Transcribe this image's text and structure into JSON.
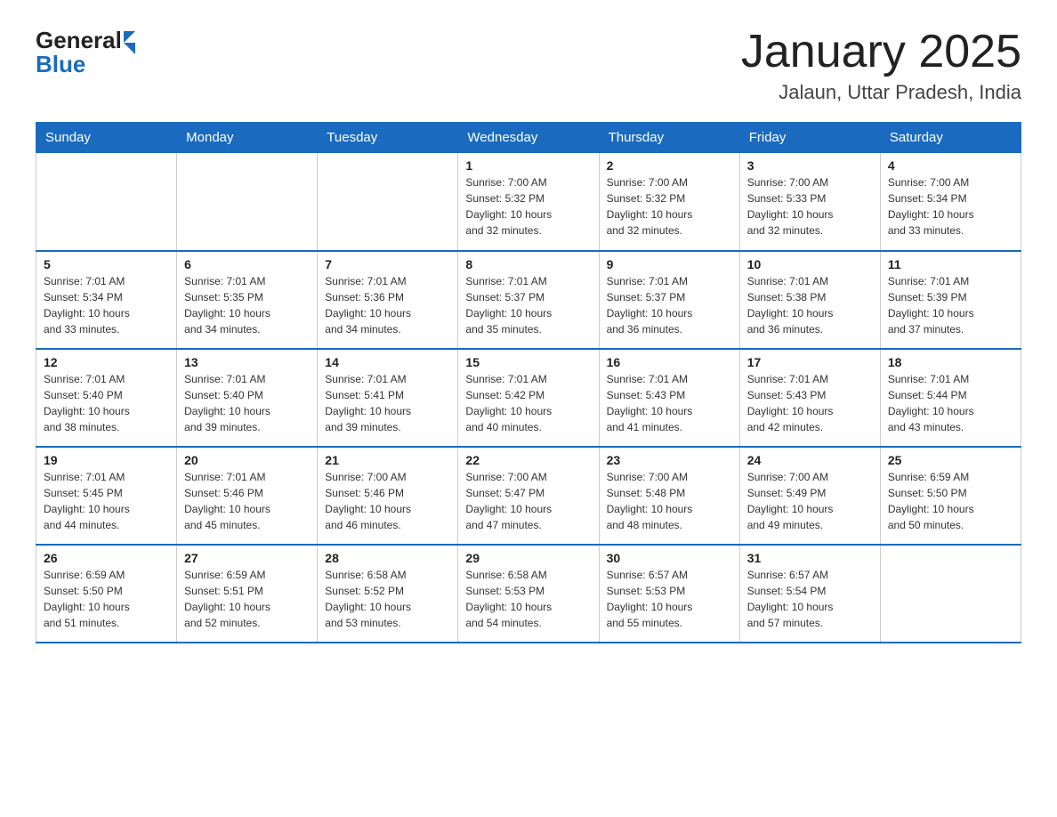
{
  "header": {
    "logo_general": "General",
    "logo_blue": "Blue",
    "title": "January 2025",
    "subtitle": "Jalaun, Uttar Pradesh, India"
  },
  "weekdays": [
    "Sunday",
    "Monday",
    "Tuesday",
    "Wednesday",
    "Thursday",
    "Friday",
    "Saturday"
  ],
  "weeks": [
    [
      {
        "day": "",
        "info": ""
      },
      {
        "day": "",
        "info": ""
      },
      {
        "day": "",
        "info": ""
      },
      {
        "day": "1",
        "info": "Sunrise: 7:00 AM\nSunset: 5:32 PM\nDaylight: 10 hours\nand 32 minutes."
      },
      {
        "day": "2",
        "info": "Sunrise: 7:00 AM\nSunset: 5:32 PM\nDaylight: 10 hours\nand 32 minutes."
      },
      {
        "day": "3",
        "info": "Sunrise: 7:00 AM\nSunset: 5:33 PM\nDaylight: 10 hours\nand 32 minutes."
      },
      {
        "day": "4",
        "info": "Sunrise: 7:00 AM\nSunset: 5:34 PM\nDaylight: 10 hours\nand 33 minutes."
      }
    ],
    [
      {
        "day": "5",
        "info": "Sunrise: 7:01 AM\nSunset: 5:34 PM\nDaylight: 10 hours\nand 33 minutes."
      },
      {
        "day": "6",
        "info": "Sunrise: 7:01 AM\nSunset: 5:35 PM\nDaylight: 10 hours\nand 34 minutes."
      },
      {
        "day": "7",
        "info": "Sunrise: 7:01 AM\nSunset: 5:36 PM\nDaylight: 10 hours\nand 34 minutes."
      },
      {
        "day": "8",
        "info": "Sunrise: 7:01 AM\nSunset: 5:37 PM\nDaylight: 10 hours\nand 35 minutes."
      },
      {
        "day": "9",
        "info": "Sunrise: 7:01 AM\nSunset: 5:37 PM\nDaylight: 10 hours\nand 36 minutes."
      },
      {
        "day": "10",
        "info": "Sunrise: 7:01 AM\nSunset: 5:38 PM\nDaylight: 10 hours\nand 36 minutes."
      },
      {
        "day": "11",
        "info": "Sunrise: 7:01 AM\nSunset: 5:39 PM\nDaylight: 10 hours\nand 37 minutes."
      }
    ],
    [
      {
        "day": "12",
        "info": "Sunrise: 7:01 AM\nSunset: 5:40 PM\nDaylight: 10 hours\nand 38 minutes."
      },
      {
        "day": "13",
        "info": "Sunrise: 7:01 AM\nSunset: 5:40 PM\nDaylight: 10 hours\nand 39 minutes."
      },
      {
        "day": "14",
        "info": "Sunrise: 7:01 AM\nSunset: 5:41 PM\nDaylight: 10 hours\nand 39 minutes."
      },
      {
        "day": "15",
        "info": "Sunrise: 7:01 AM\nSunset: 5:42 PM\nDaylight: 10 hours\nand 40 minutes."
      },
      {
        "day": "16",
        "info": "Sunrise: 7:01 AM\nSunset: 5:43 PM\nDaylight: 10 hours\nand 41 minutes."
      },
      {
        "day": "17",
        "info": "Sunrise: 7:01 AM\nSunset: 5:43 PM\nDaylight: 10 hours\nand 42 minutes."
      },
      {
        "day": "18",
        "info": "Sunrise: 7:01 AM\nSunset: 5:44 PM\nDaylight: 10 hours\nand 43 minutes."
      }
    ],
    [
      {
        "day": "19",
        "info": "Sunrise: 7:01 AM\nSunset: 5:45 PM\nDaylight: 10 hours\nand 44 minutes."
      },
      {
        "day": "20",
        "info": "Sunrise: 7:01 AM\nSunset: 5:46 PM\nDaylight: 10 hours\nand 45 minutes."
      },
      {
        "day": "21",
        "info": "Sunrise: 7:00 AM\nSunset: 5:46 PM\nDaylight: 10 hours\nand 46 minutes."
      },
      {
        "day": "22",
        "info": "Sunrise: 7:00 AM\nSunset: 5:47 PM\nDaylight: 10 hours\nand 47 minutes."
      },
      {
        "day": "23",
        "info": "Sunrise: 7:00 AM\nSunset: 5:48 PM\nDaylight: 10 hours\nand 48 minutes."
      },
      {
        "day": "24",
        "info": "Sunrise: 7:00 AM\nSunset: 5:49 PM\nDaylight: 10 hours\nand 49 minutes."
      },
      {
        "day": "25",
        "info": "Sunrise: 6:59 AM\nSunset: 5:50 PM\nDaylight: 10 hours\nand 50 minutes."
      }
    ],
    [
      {
        "day": "26",
        "info": "Sunrise: 6:59 AM\nSunset: 5:50 PM\nDaylight: 10 hours\nand 51 minutes."
      },
      {
        "day": "27",
        "info": "Sunrise: 6:59 AM\nSunset: 5:51 PM\nDaylight: 10 hours\nand 52 minutes."
      },
      {
        "day": "28",
        "info": "Sunrise: 6:58 AM\nSunset: 5:52 PM\nDaylight: 10 hours\nand 53 minutes."
      },
      {
        "day": "29",
        "info": "Sunrise: 6:58 AM\nSunset: 5:53 PM\nDaylight: 10 hours\nand 54 minutes."
      },
      {
        "day": "30",
        "info": "Sunrise: 6:57 AM\nSunset: 5:53 PM\nDaylight: 10 hours\nand 55 minutes."
      },
      {
        "day": "31",
        "info": "Sunrise: 6:57 AM\nSunset: 5:54 PM\nDaylight: 10 hours\nand 57 minutes."
      },
      {
        "day": "",
        "info": ""
      }
    ]
  ]
}
